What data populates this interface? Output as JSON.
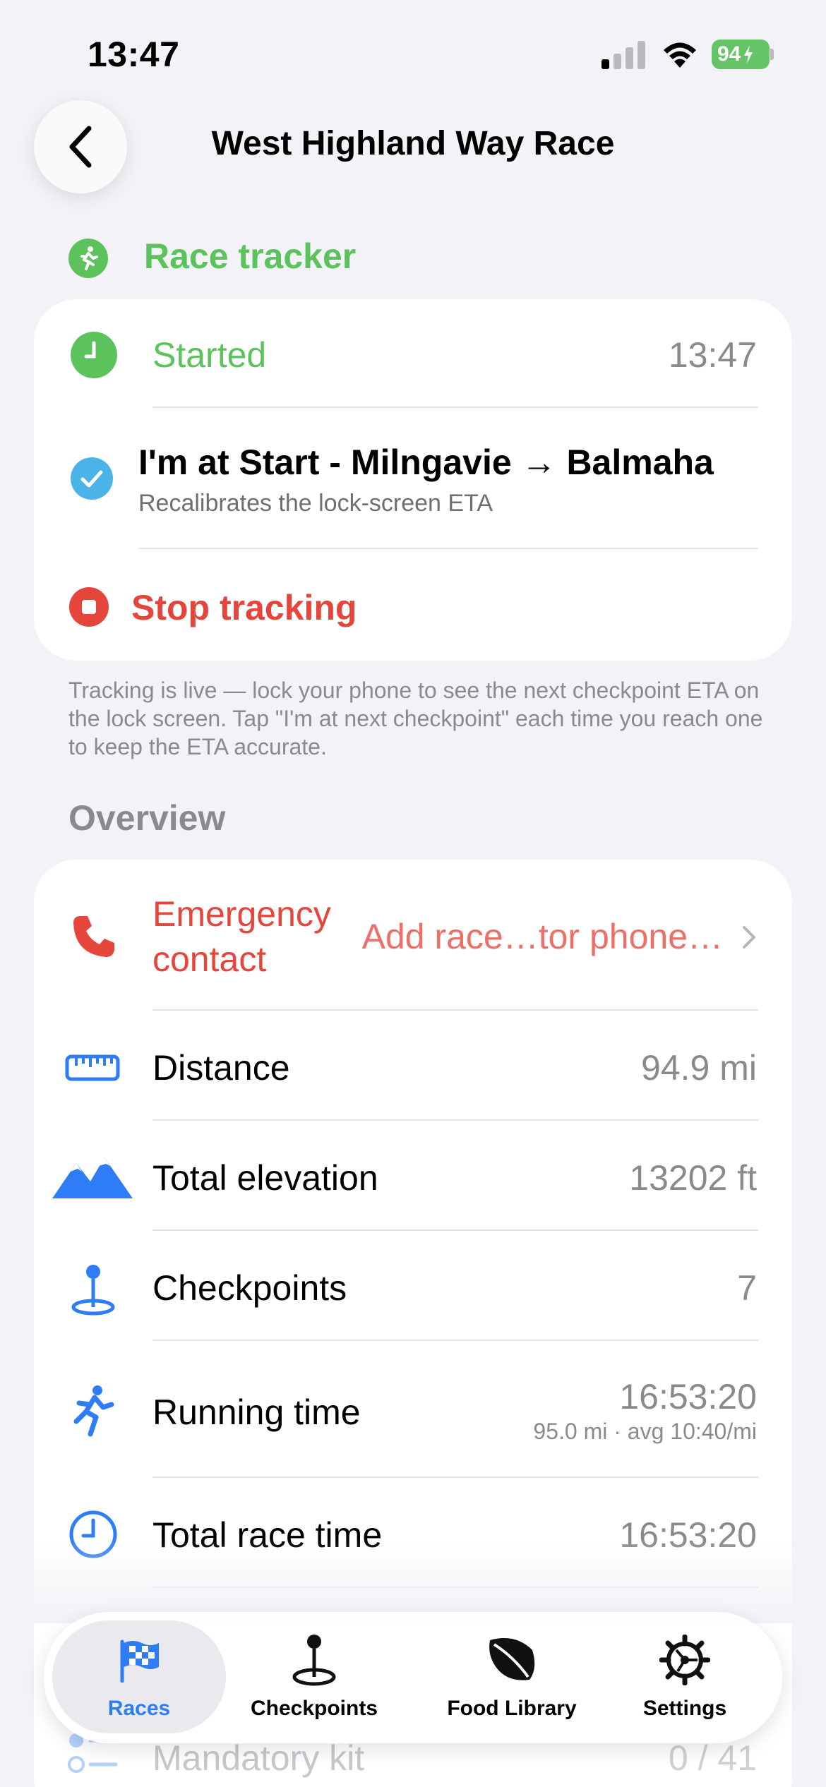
{
  "status_bar": {
    "time": "13:47",
    "battery": "94"
  },
  "nav": {
    "title": "West Highland Way Race"
  },
  "race_tracker": {
    "header": "Race tracker",
    "started_label": "Started",
    "started_time": "13:47",
    "checkpoint_title": "I'm at Start - Milngavie → Balmaha",
    "checkpoint_subtitle": "Recalibrates the lock-screen ETA",
    "stop_label": "Stop tracking",
    "footnote": "Tracking is live — lock your phone to see the next checkpoint ETA on the lock screen. Tap \"I'm at next checkpoint\" each time you reach one to keep the ETA accurate."
  },
  "overview": {
    "header": "Overview",
    "emergency_label_1": "Emergency",
    "emergency_label_2": "contact",
    "emergency_value": "Add race…tor phone…",
    "distance_label": "Distance",
    "distance_value": "94.9 mi",
    "elevation_label": "Total elevation",
    "elevation_value": "13202 ft",
    "checkpoints_label": "Checkpoints",
    "checkpoints_value": "7",
    "running_label": "Running time",
    "running_value": "16:53:20",
    "running_sub": "95.0 mi · avg 10:40/mi",
    "race_time_label": "Total race time",
    "race_time_value": "16:53:20",
    "mandatory_label": "Mandatory kit",
    "mandatory_value": "0 / 41"
  },
  "tabs": [
    {
      "label": "Races"
    },
    {
      "label": "Checkpoints"
    },
    {
      "label": "Food Library"
    },
    {
      "label": "Settings"
    }
  ],
  "colors": {
    "green": "#5bc25c",
    "red": "#e5453a",
    "blue": "#2f7df6",
    "gray": "#8a8a8e"
  }
}
